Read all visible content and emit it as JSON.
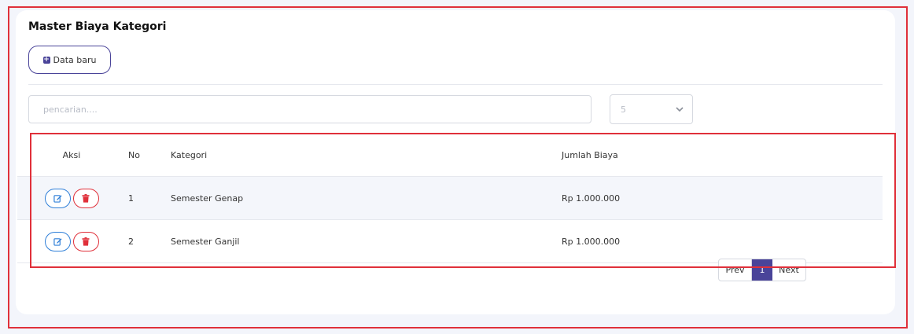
{
  "page": {
    "title": "Master Biaya Kategori",
    "new_button_label": "Data baru"
  },
  "filters": {
    "search_placeholder": "pencarian....",
    "page_size_value": "5"
  },
  "table": {
    "headers": {
      "aksi": "Aksi",
      "no": "No",
      "kategori": "Kategori",
      "jumlah": "Jumlah Biaya"
    },
    "rows": [
      {
        "no": "1",
        "kategori": "Semester Genap",
        "jumlah": "Rp 1.000.000"
      },
      {
        "no": "2",
        "kategori": "Semester Ganjil",
        "jumlah": "Rp 1.000.000"
      }
    ]
  },
  "pagination": {
    "prev": "Prev",
    "current": "1",
    "next": "Next"
  },
  "colors": {
    "accent": "#4a4499",
    "edit": "#2f7fd8",
    "delete": "#e0303a",
    "highlight_frame": "#e0303a"
  },
  "icons": {
    "new_button": "plus-square-icon",
    "edit_button": "edit-icon",
    "delete_button": "trash-icon",
    "page_size": "chevron-down-icon"
  }
}
